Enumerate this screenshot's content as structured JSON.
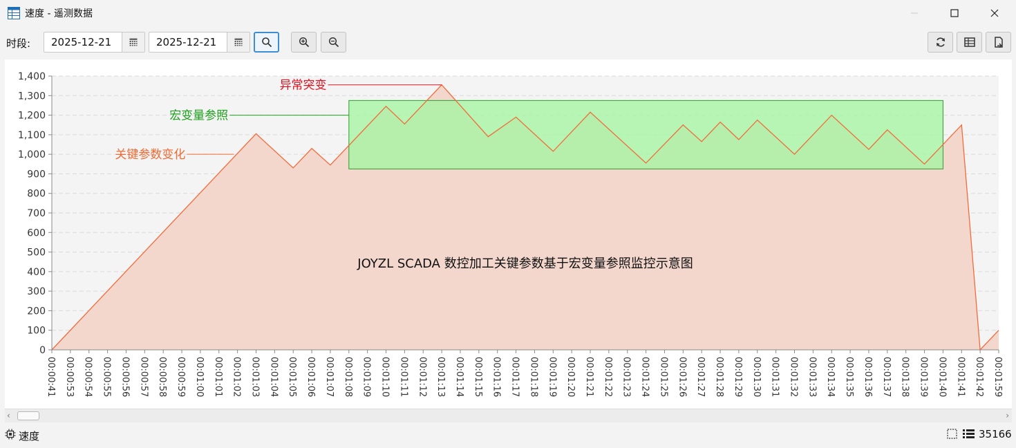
{
  "window": {
    "title": "速度 - 遥测数据"
  },
  "toolbar": {
    "period_label": "时段:",
    "start_date": "2025-12-21",
    "end_date": "2025-12-21"
  },
  "status": {
    "series_label": "速度",
    "count": "35166"
  },
  "colors": {
    "line": "#f26b3a",
    "fill": "#f3d6cc",
    "reference_fill": "#a6f5a3",
    "reference_border": "#2e9a2e",
    "anomaly_label": "#e0101e",
    "param_label": "#ee6b35",
    "ref_label": "#1ea01e"
  },
  "chart_data": {
    "type": "area",
    "title": "JOYZL SCADA 数控加工关键参数基于宏变量参照监控示意图",
    "xlabel": "",
    "ylabel": "",
    "ylim": [
      0,
      1400
    ],
    "yticks": [
      0,
      100,
      200,
      300,
      400,
      500,
      600,
      700,
      800,
      900,
      1000,
      1100,
      1200,
      1300,
      1400
    ],
    "ytick_labels": [
      "0",
      "100",
      "200",
      "300",
      "400",
      "500",
      "600",
      "700",
      "800",
      "900",
      "1,000",
      "1,100",
      "1,200",
      "1,300",
      "1,400"
    ],
    "grid": true,
    "categories": [
      "00:00:41",
      "00:00:53",
      "00:00:54",
      "00:00:55",
      "00:00:56",
      "00:00:57",
      "00:00:58",
      "00:00:59",
      "00:01:00",
      "00:01:01",
      "00:01:02",
      "00:01:03",
      "00:01:04",
      "00:01:05",
      "00:01:06",
      "00:01:07",
      "00:01:08",
      "00:01:09",
      "00:01:10",
      "00:01:11",
      "00:01:12",
      "00:01:13",
      "00:01:14",
      "00:01:15",
      "00:01:16",
      "00:01:17",
      "00:01:18",
      "00:01:19",
      "00:01:20",
      "00:01:21",
      "00:01:22",
      "00:01:23",
      "00:01:24",
      "00:01:25",
      "00:01:26",
      "00:01:27",
      "00:01:28",
      "00:01:29",
      "00:01:30",
      "00:01:31",
      "00:01:32",
      "00:01:33",
      "00:01:34",
      "00:01:35",
      "00:01:36",
      "00:01:37",
      "00:01:38",
      "00:01:39",
      "00:01:40",
      "00:01:41",
      "00:01:42",
      "00:01:59"
    ],
    "series": [
      {
        "points": [
          [
            0,
            0
          ],
          [
            11,
            1105
          ],
          [
            13,
            930
          ],
          [
            14,
            1030
          ],
          [
            15,
            945
          ],
          [
            18,
            1245
          ],
          [
            19,
            1155
          ],
          [
            21,
            1355
          ],
          [
            23.5,
            1090
          ],
          [
            25,
            1190
          ],
          [
            27,
            1015
          ],
          [
            29,
            1215
          ],
          [
            32,
            955
          ],
          [
            34,
            1150
          ],
          [
            35,
            1065
          ],
          [
            36,
            1165
          ],
          [
            37,
            1075
          ],
          [
            38,
            1175
          ],
          [
            40,
            1000
          ],
          [
            42,
            1200
          ],
          [
            44,
            1025
          ],
          [
            45,
            1125
          ],
          [
            47,
            950
          ],
          [
            49,
            1150
          ],
          [
            50,
            0
          ],
          [
            51,
            100
          ]
        ]
      }
    ],
    "reference_band": {
      "label": "宏变量参照",
      "x_start": 16,
      "x_end": 48,
      "y_min": 925,
      "y_max": 1275
    },
    "annotations": [
      {
        "text": "异常突变",
        "x": 21,
        "y": 1355,
        "label_x": 14.8,
        "label_y": 1355
      },
      {
        "text": "宏变量参照",
        "x": 16,
        "y": 1200,
        "label_x": 9.5,
        "label_y": 1200
      },
      {
        "text": "关键参数变化",
        "x": 9.8,
        "y": 1000,
        "label_x": 7.2,
        "label_y": 1000
      }
    ]
  }
}
